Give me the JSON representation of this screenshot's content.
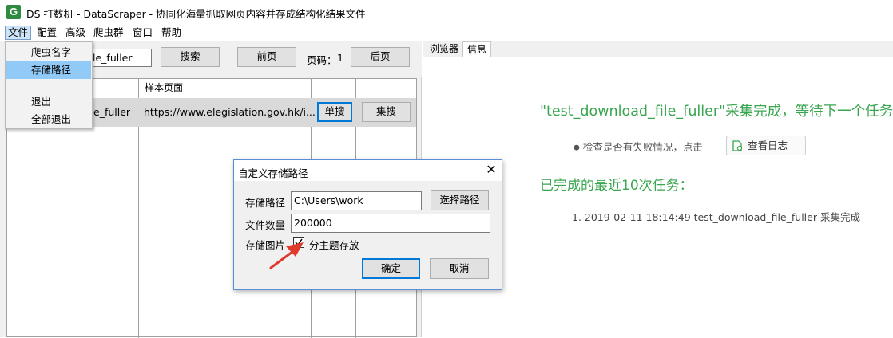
{
  "window": {
    "app_icon_letter": "G",
    "title": "DS 打数机 - DataScraper - 协同化海量抓取网页内容并存成结构化结果文件"
  },
  "menubar": {
    "items": [
      "文件",
      "配置",
      "高级",
      "爬虫群",
      "窗口",
      "帮助"
    ]
  },
  "file_menu": {
    "items": [
      "爬虫名字",
      "存储路径",
      "退出",
      "全部退出"
    ],
    "highlighted": "存储路径"
  },
  "toolbar": {
    "crawler_name_value": "le_fuller",
    "search_label": "搜索",
    "prev_label": "前页",
    "page_label": "页码：",
    "page_number": "1",
    "next_label": "后页"
  },
  "grid": {
    "headers": [
      "",
      "样本页面",
      "",
      ""
    ],
    "row": {
      "name": "e_fuller",
      "url": "https://www.elegislation.gov.hk/i...",
      "single_label": "单搜",
      "batch_label": "集搜"
    }
  },
  "tabs": [
    "浏览器",
    "信息"
  ],
  "info": {
    "status_name": "\"test_download_file_fuller\"",
    "status_suffix": "采集完成，等待下一个任务",
    "check_text": "检查是否有失败情况，点击",
    "log_button": "查看日志",
    "recent_title": "已完成的最近10次任务：",
    "recent_items": [
      "1. 2019-02-11 18:14:49 test_download_file_fuller 采集完成"
    ]
  },
  "dialog": {
    "title": "自定义存储路径",
    "path_label": "存储路径",
    "path_value": "C:\\Users\\work",
    "choose_path_label": "选择路径",
    "count_label": "文件数量",
    "count_value": "200000",
    "image_label": "存储图片",
    "checkbox_label": "分主题存放",
    "checkbox_checked": true,
    "ok_label": "确定",
    "cancel_label": "取消"
  },
  "colors": {
    "accent_green": "#3aa650",
    "app_icon": "#2e8b3f",
    "highlight": "#91c9f7",
    "focus_blue": "#0078d7",
    "arrow_red": "#e03a2f"
  }
}
